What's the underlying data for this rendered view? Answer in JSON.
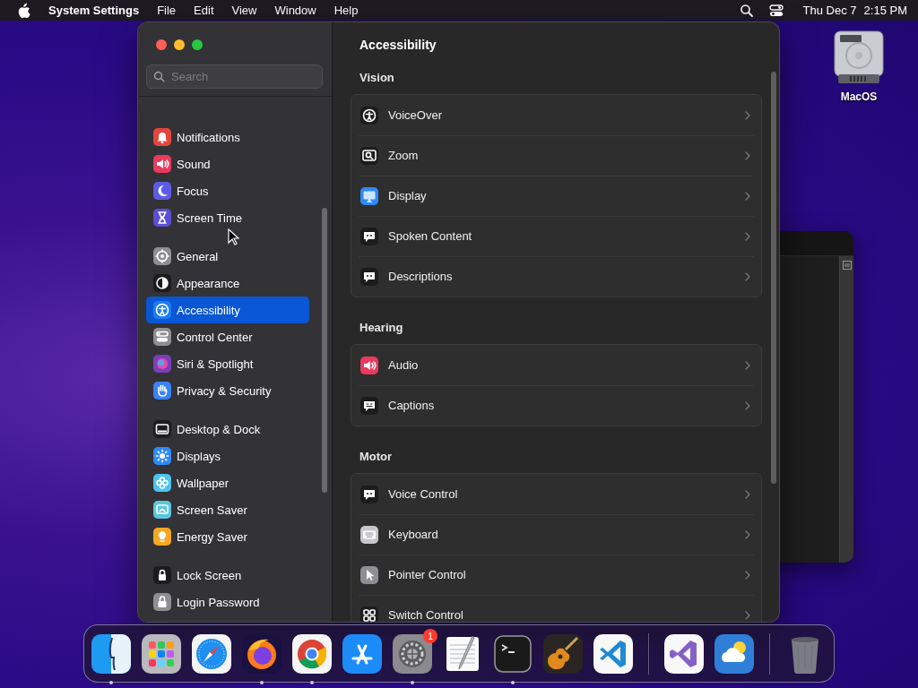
{
  "menu_bar": {
    "app_name": "System Settings",
    "menus": [
      "File",
      "Edit",
      "View",
      "Window",
      "Help"
    ],
    "date": "Thu Dec 7",
    "time": "2:15 PM"
  },
  "desktop_icons": [
    {
      "label": "MacOS"
    }
  ],
  "settings_window": {
    "search": {
      "placeholder": "Search"
    },
    "sidebar": {
      "groups": [
        {
          "items": [
            {
              "label": "Notifications",
              "kind": "bell",
              "color": "#e5453f",
              "selected": false
            },
            {
              "label": "Sound",
              "kind": "speaker",
              "color": "#ea3a5e",
              "selected": false
            },
            {
              "label": "Focus",
              "kind": "moon",
              "color": "#5e5ce6",
              "selected": false
            },
            {
              "label": "Screen Time",
              "kind": "hourglass",
              "color": "#5b4fd3",
              "selected": false
            }
          ]
        },
        {
          "items": [
            {
              "label": "General",
              "kind": "gear",
              "color": "#8e8e93",
              "selected": false
            },
            {
              "label": "Appearance",
              "kind": "contrast",
              "color": "#1c1c1e",
              "selected": false
            },
            {
              "label": "Accessibility",
              "kind": "person",
              "color": "#1a7df5",
              "selected": true
            },
            {
              "label": "Control Center",
              "kind": "toggles",
              "color": "#8e8e93",
              "selected": false
            },
            {
              "label": "Siri & Spotlight",
              "kind": "orb",
              "color": "#7a3fb8",
              "selected": false
            },
            {
              "label": "Privacy & Security",
              "kind": "hand",
              "color": "#3a82f7",
              "selected": false
            }
          ]
        },
        {
          "items": [
            {
              "label": "Desktop & Dock",
              "kind": "dock",
              "color": "#1c1c1e",
              "selected": false
            },
            {
              "label": "Displays",
              "kind": "sun",
              "color": "#2f8af5",
              "selected": false
            },
            {
              "label": "Wallpaper",
              "kind": "flower",
              "color": "#4fc3f0",
              "selected": false
            },
            {
              "label": "Screen Saver",
              "kind": "screen",
              "color": "#5bc6e0",
              "selected": false
            },
            {
              "label": "Energy Saver",
              "kind": "bulb",
              "color": "#f5a623",
              "selected": false
            }
          ]
        },
        {
          "items": [
            {
              "label": "Lock Screen",
              "kind": "lock",
              "color": "#1c1c1e",
              "selected": false
            },
            {
              "label": "Login Password",
              "kind": "padlock",
              "color": "#8e8e93",
              "selected": false
            }
          ]
        }
      ]
    },
    "title": "Accessibility",
    "sections": [
      {
        "heading": "Vision",
        "rows": [
          {
            "label": "VoiceOver",
            "kind": "person",
            "color": "#1c1c1e"
          },
          {
            "label": "Zoom",
            "kind": "magnifier",
            "color": "#1c1c1e"
          },
          {
            "label": "Display",
            "kind": "monitor",
            "color": "#2f8af5"
          },
          {
            "label": "Spoken Content",
            "kind": "bubble",
            "color": "#1c1c1e"
          },
          {
            "label": "Descriptions",
            "kind": "bubble",
            "color": "#1c1c1e"
          }
        ]
      },
      {
        "heading": "Hearing",
        "rows": [
          {
            "label": "Audio",
            "kind": "speaker",
            "color": "#ea3a5e"
          },
          {
            "label": "Captions",
            "kind": "captions",
            "color": "#1c1c1e"
          }
        ]
      },
      {
        "heading": "Motor",
        "rows": [
          {
            "label": "Voice Control",
            "kind": "bubble",
            "color": "#1c1c1e"
          },
          {
            "label": "Keyboard",
            "kind": "keyboard",
            "color": "#c7c7cc"
          },
          {
            "label": "Pointer Control",
            "kind": "pointer",
            "color": "#8e8e93"
          },
          {
            "label": "Switch Control",
            "kind": "grid",
            "color": "#1c1c1e"
          }
        ]
      }
    ]
  },
  "dock": {
    "sections": [
      [
        {
          "kind": "finder",
          "running": true
        },
        {
          "kind": "grid",
          "running": false
        },
        {
          "kind": "compass",
          "running": false
        },
        {
          "kind": "fox",
          "running": true
        },
        {
          "kind": "wheel",
          "running": true
        },
        {
          "kind": "store",
          "running": false
        },
        {
          "kind": "gear",
          "running": true,
          "badge": "1"
        },
        {
          "kind": "notes",
          "running": false
        },
        {
          "kind": "terminal",
          "running": true
        },
        {
          "kind": "guitar",
          "running": false
        },
        {
          "kind": "code",
          "running": false
        }
      ],
      [
        {
          "kind": "ribbon",
          "running": false
        },
        {
          "kind": "weather",
          "running": false
        }
      ],
      [
        {
          "kind": "trash",
          "running": false
        }
      ]
    ]
  }
}
